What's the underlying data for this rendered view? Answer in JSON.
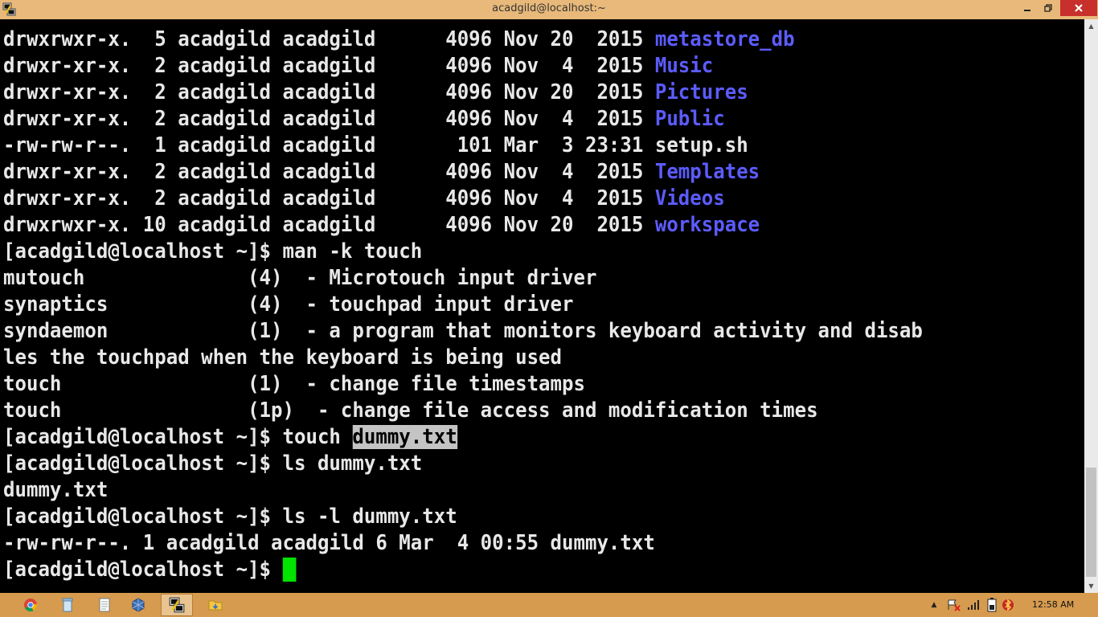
{
  "window": {
    "title": "acadgild@localhost:~"
  },
  "terminal": {
    "lines": [
      {
        "text": "drwxrwxr-x.  5 acadgild acadgild      4096 Nov 20  2015 ",
        "dir": "metastore_db"
      },
      {
        "text": "drwxr-xr-x.  2 acadgild acadgild      4096 Nov  4  2015 ",
        "dir": "Music"
      },
      {
        "text": "drwxr-xr-x.  2 acadgild acadgild      4096 Nov 20  2015 ",
        "dir": "Pictures"
      },
      {
        "text": "drwxr-xr-x.  2 acadgild acadgild      4096 Nov  4  2015 ",
        "dir": "Public"
      },
      {
        "text": "-rw-rw-r--.  1 acadgild acadgild       101 Mar  3 23:31 setup.sh"
      },
      {
        "text": "drwxr-xr-x.  2 acadgild acadgild      4096 Nov  4  2015 ",
        "dir": "Templates"
      },
      {
        "text": "drwxr-xr-x.  2 acadgild acadgild      4096 Nov  4  2015 ",
        "dir": "Videos"
      },
      {
        "text": "drwxrwxr-x. 10 acadgild acadgild      4096 Nov 20  2015 ",
        "dir": "workspace"
      },
      {
        "text": "[acadgild@localhost ~]$ man -k touch"
      },
      {
        "text": "mutouch              (4)  - Microtouch input driver"
      },
      {
        "text": "synaptics            (4)  - touchpad input driver"
      },
      {
        "text": "syndaemon            (1)  - a program that monitors keyboard activity and disab"
      },
      {
        "text": "les the touchpad when the keyboard is being used"
      },
      {
        "text": "touch                (1)  - change file timestamps"
      },
      {
        "text": "touch                (1p)  - change file access and modification times"
      },
      {
        "text": "[acadgild@localhost ~]$ touch ",
        "sel": "dummy.txt"
      },
      {
        "text": "[acadgild@localhost ~]$ ls dummy.txt"
      },
      {
        "text": "dummy.txt"
      },
      {
        "text": "[acadgild@localhost ~]$ ls -l dummy.txt"
      },
      {
        "text": "-rw-rw-r--. 1 acadgild acadgild 6 Mar  4 00:55 dummy.txt"
      },
      {
        "text": "[acadgild@localhost ~]$ ",
        "cursor": true
      }
    ]
  },
  "taskbar": {
    "items": [
      {
        "icon": "chrome-icon"
      },
      {
        "icon": "recycle-bin-icon"
      },
      {
        "icon": "notepad-icon"
      },
      {
        "icon": "virtualbox-icon"
      },
      {
        "icon": "putty-icon",
        "active": true
      },
      {
        "icon": "file-explorer-icon"
      }
    ],
    "tray_icons": [
      "show-hidden-icons-icon",
      "action-center-icon",
      "network-signal-icon",
      "battery-icon",
      "bluetooth-icon"
    ],
    "clock": "12:58 AM"
  },
  "colors": {
    "terminal_bg": "#000000",
    "terminal_fg": "#e8e8e8",
    "directory": "#5c5cff",
    "cursor": "#00e400",
    "titlebar": "#e8b97a",
    "taskbar": "#d69b4f",
    "close_button": "#c7302b"
  }
}
